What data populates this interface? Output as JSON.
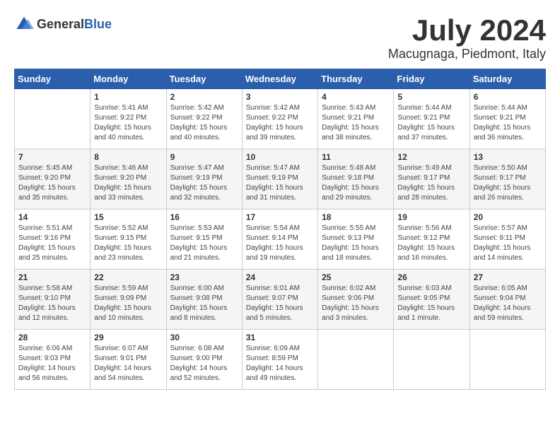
{
  "header": {
    "logo_general": "General",
    "logo_blue": "Blue",
    "month_title": "July 2024",
    "location": "Macugnaga, Piedmont, Italy"
  },
  "weekdays": [
    "Sunday",
    "Monday",
    "Tuesday",
    "Wednesday",
    "Thursday",
    "Friday",
    "Saturday"
  ],
  "weeks": [
    [
      {
        "day": "",
        "lines": []
      },
      {
        "day": "1",
        "lines": [
          "Sunrise: 5:41 AM",
          "Sunset: 9:22 PM",
          "Daylight: 15 hours",
          "and 40 minutes."
        ]
      },
      {
        "day": "2",
        "lines": [
          "Sunrise: 5:42 AM",
          "Sunset: 9:22 PM",
          "Daylight: 15 hours",
          "and 40 minutes."
        ]
      },
      {
        "day": "3",
        "lines": [
          "Sunrise: 5:42 AM",
          "Sunset: 9:22 PM",
          "Daylight: 15 hours",
          "and 39 minutes."
        ]
      },
      {
        "day": "4",
        "lines": [
          "Sunrise: 5:43 AM",
          "Sunset: 9:21 PM",
          "Daylight: 15 hours",
          "and 38 minutes."
        ]
      },
      {
        "day": "5",
        "lines": [
          "Sunrise: 5:44 AM",
          "Sunset: 9:21 PM",
          "Daylight: 15 hours",
          "and 37 minutes."
        ]
      },
      {
        "day": "6",
        "lines": [
          "Sunrise: 5:44 AM",
          "Sunset: 9:21 PM",
          "Daylight: 15 hours",
          "and 36 minutes."
        ]
      }
    ],
    [
      {
        "day": "7",
        "lines": [
          "Sunrise: 5:45 AM",
          "Sunset: 9:20 PM",
          "Daylight: 15 hours",
          "and 35 minutes."
        ]
      },
      {
        "day": "8",
        "lines": [
          "Sunrise: 5:46 AM",
          "Sunset: 9:20 PM",
          "Daylight: 15 hours",
          "and 33 minutes."
        ]
      },
      {
        "day": "9",
        "lines": [
          "Sunrise: 5:47 AM",
          "Sunset: 9:19 PM",
          "Daylight: 15 hours",
          "and 32 minutes."
        ]
      },
      {
        "day": "10",
        "lines": [
          "Sunrise: 5:47 AM",
          "Sunset: 9:19 PM",
          "Daylight: 15 hours",
          "and 31 minutes."
        ]
      },
      {
        "day": "11",
        "lines": [
          "Sunrise: 5:48 AM",
          "Sunset: 9:18 PM",
          "Daylight: 15 hours",
          "and 29 minutes."
        ]
      },
      {
        "day": "12",
        "lines": [
          "Sunrise: 5:49 AM",
          "Sunset: 9:17 PM",
          "Daylight: 15 hours",
          "and 28 minutes."
        ]
      },
      {
        "day": "13",
        "lines": [
          "Sunrise: 5:50 AM",
          "Sunset: 9:17 PM",
          "Daylight: 15 hours",
          "and 26 minutes."
        ]
      }
    ],
    [
      {
        "day": "14",
        "lines": [
          "Sunrise: 5:51 AM",
          "Sunset: 9:16 PM",
          "Daylight: 15 hours",
          "and 25 minutes."
        ]
      },
      {
        "day": "15",
        "lines": [
          "Sunrise: 5:52 AM",
          "Sunset: 9:15 PM",
          "Daylight: 15 hours",
          "and 23 minutes."
        ]
      },
      {
        "day": "16",
        "lines": [
          "Sunrise: 5:53 AM",
          "Sunset: 9:15 PM",
          "Daylight: 15 hours",
          "and 21 minutes."
        ]
      },
      {
        "day": "17",
        "lines": [
          "Sunrise: 5:54 AM",
          "Sunset: 9:14 PM",
          "Daylight: 15 hours",
          "and 19 minutes."
        ]
      },
      {
        "day": "18",
        "lines": [
          "Sunrise: 5:55 AM",
          "Sunset: 9:13 PM",
          "Daylight: 15 hours",
          "and 18 minutes."
        ]
      },
      {
        "day": "19",
        "lines": [
          "Sunrise: 5:56 AM",
          "Sunset: 9:12 PM",
          "Daylight: 15 hours",
          "and 16 minutes."
        ]
      },
      {
        "day": "20",
        "lines": [
          "Sunrise: 5:57 AM",
          "Sunset: 9:11 PM",
          "Daylight: 15 hours",
          "and 14 minutes."
        ]
      }
    ],
    [
      {
        "day": "21",
        "lines": [
          "Sunrise: 5:58 AM",
          "Sunset: 9:10 PM",
          "Daylight: 15 hours",
          "and 12 minutes."
        ]
      },
      {
        "day": "22",
        "lines": [
          "Sunrise: 5:59 AM",
          "Sunset: 9:09 PM",
          "Daylight: 15 hours",
          "and 10 minutes."
        ]
      },
      {
        "day": "23",
        "lines": [
          "Sunrise: 6:00 AM",
          "Sunset: 9:08 PM",
          "Daylight: 15 hours",
          "and 8 minutes."
        ]
      },
      {
        "day": "24",
        "lines": [
          "Sunrise: 6:01 AM",
          "Sunset: 9:07 PM",
          "Daylight: 15 hours",
          "and 5 minutes."
        ]
      },
      {
        "day": "25",
        "lines": [
          "Sunrise: 6:02 AM",
          "Sunset: 9:06 PM",
          "Daylight: 15 hours",
          "and 3 minutes."
        ]
      },
      {
        "day": "26",
        "lines": [
          "Sunrise: 6:03 AM",
          "Sunset: 9:05 PM",
          "Daylight: 15 hours",
          "and 1 minute."
        ]
      },
      {
        "day": "27",
        "lines": [
          "Sunrise: 6:05 AM",
          "Sunset: 9:04 PM",
          "Daylight: 14 hours",
          "and 59 minutes."
        ]
      }
    ],
    [
      {
        "day": "28",
        "lines": [
          "Sunrise: 6:06 AM",
          "Sunset: 9:03 PM",
          "Daylight: 14 hours",
          "and 56 minutes."
        ]
      },
      {
        "day": "29",
        "lines": [
          "Sunrise: 6:07 AM",
          "Sunset: 9:01 PM",
          "Daylight: 14 hours",
          "and 54 minutes."
        ]
      },
      {
        "day": "30",
        "lines": [
          "Sunrise: 6:08 AM",
          "Sunset: 9:00 PM",
          "Daylight: 14 hours",
          "and 52 minutes."
        ]
      },
      {
        "day": "31",
        "lines": [
          "Sunrise: 6:09 AM",
          "Sunset: 8:59 PM",
          "Daylight: 14 hours",
          "and 49 minutes."
        ]
      },
      {
        "day": "",
        "lines": []
      },
      {
        "day": "",
        "lines": []
      },
      {
        "day": "",
        "lines": []
      }
    ]
  ]
}
